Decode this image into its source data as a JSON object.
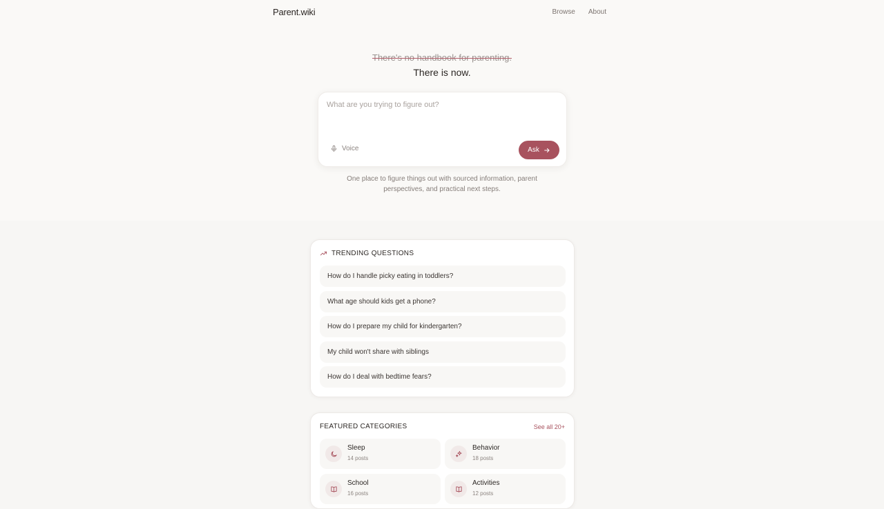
{
  "header": {
    "brand": "Parent.wiki",
    "nav": [
      "Browse",
      "About"
    ]
  },
  "hero": {
    "struck_line": "There's no handbook for parenting.",
    "headline": "There is now.",
    "ask_placeholder": "What are you trying to figure out?",
    "voice_label": "Voice",
    "voice_icon": "microphone-icon",
    "ask_label": "Ask",
    "ask_icon": "arrow-right-icon",
    "tagline": "One place to figure things out with sourced information, parent perspectives, and practical next steps."
  },
  "trending": {
    "title": "TRENDING QUESTIONS",
    "icon": "trending-up-icon",
    "questions": [
      "How do I handle picky eating in toddlers?",
      "What age should kids get a phone?",
      "How do I prepare my child for kindergarten?",
      "My child won't share with siblings",
      "How do I deal with bedtime fears?"
    ]
  },
  "featured": {
    "title": "FEATURED CATEGORIES",
    "see_all": "See all 20+",
    "categories": [
      {
        "name": "Sleep",
        "count": "14 posts",
        "icon": "moon-icon"
      },
      {
        "name": "Behavior",
        "count": "18 posts",
        "icon": "sparkles-icon"
      },
      {
        "name": "School",
        "count": "16 posts",
        "icon": "book-icon"
      },
      {
        "name": "Activities",
        "count": "12 posts",
        "icon": "book-icon"
      }
    ]
  },
  "colors": {
    "accent": "#a8525e",
    "background": "#f7f6f4",
    "card": "#ffffff"
  }
}
